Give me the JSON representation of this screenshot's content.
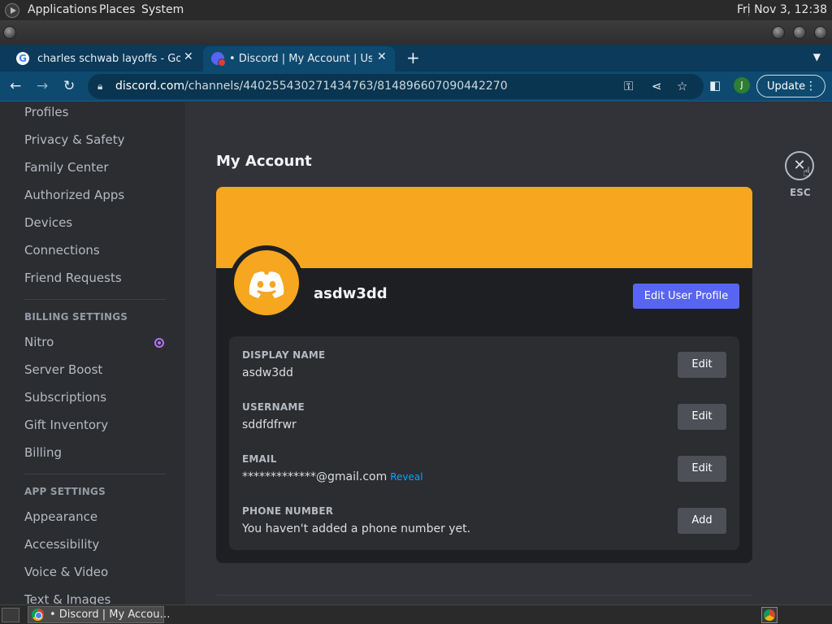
{
  "os_panel": {
    "menus": [
      "Applications",
      "Places",
      "System"
    ],
    "clock": "Fri Nov  3, 12:38"
  },
  "browser": {
    "tabs": [
      {
        "title": "charles schwab layoffs - Googl",
        "icon": "google-icon"
      },
      {
        "title": "• Discord | My Account | User S",
        "icon": "discord-icon"
      }
    ],
    "url_host": "discord.com",
    "url_path": "/channels/440255430271434763/814896607090442270",
    "profile_initial": "J",
    "update_label": "Update"
  },
  "sidebar": {
    "user_items": [
      "Profiles",
      "Privacy & Safety",
      "Family Center",
      "Authorized Apps",
      "Devices",
      "Connections",
      "Friend Requests"
    ],
    "billing_header": "BILLING SETTINGS",
    "billing_items": [
      "Nitro",
      "Server Boost",
      "Subscriptions",
      "Gift Inventory",
      "Billing"
    ],
    "app_header": "APP SETTINGS",
    "app_items": [
      "Appearance",
      "Accessibility",
      "Voice & Video",
      "Text & Images"
    ]
  },
  "main": {
    "title": "My Account",
    "esc_label": "ESC",
    "profile": {
      "name": "asdw3dd",
      "edit_profile_label": "Edit User Profile",
      "banner_color": "#f6a61f",
      "fields": [
        {
          "label": "DISPLAY NAME",
          "value": "asdw3dd",
          "action": "Edit"
        },
        {
          "label": "USERNAME",
          "value": "sddfdfrwr",
          "action": "Edit"
        },
        {
          "label": "EMAIL",
          "value": "*************@gmail.com",
          "extra": "Reveal",
          "action": "Edit"
        },
        {
          "label": "PHONE NUMBER",
          "value": "You haven't added a phone number yet.",
          "action": "Add"
        }
      ]
    }
  },
  "taskbar": {
    "window_label": "• Discord | My Accou…"
  }
}
